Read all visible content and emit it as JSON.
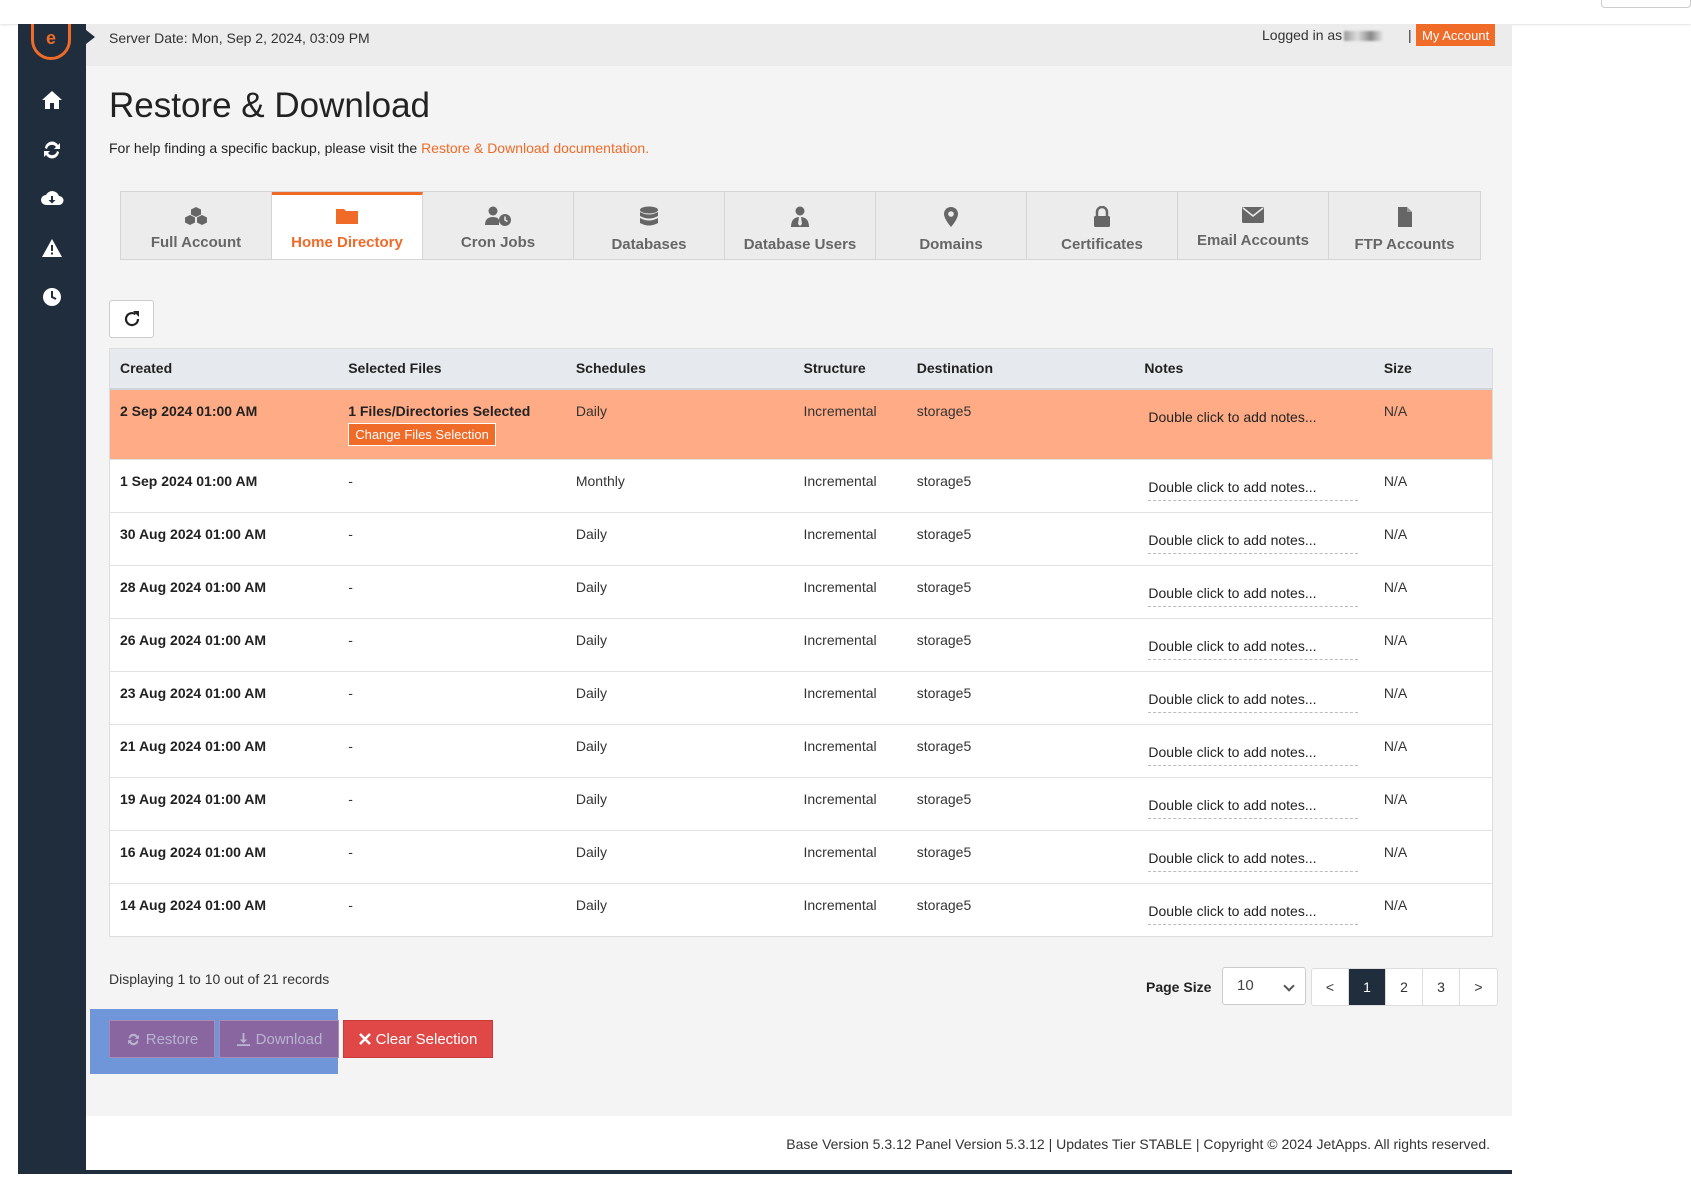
{
  "header": {
    "server_date": "Server Date: Mon, Sep 2, 2024, 03:09 PM",
    "logged_in": "Logged in as",
    "pipe": "|",
    "my_account": "My Account"
  },
  "sidebar": {
    "logo_text": "e",
    "items": [
      {
        "name": "home",
        "icon": "home-icon"
      },
      {
        "name": "sync",
        "icon": "refresh-icon"
      },
      {
        "name": "download",
        "icon": "cloud-download-icon"
      },
      {
        "name": "alerts",
        "icon": "warning-icon"
      },
      {
        "name": "history",
        "icon": "clock-icon"
      }
    ]
  },
  "page": {
    "title": "Restore & Download",
    "help_prefix": "For help finding a specific backup, please visit the ",
    "help_link": "Restore & Download documentation."
  },
  "tabs": [
    {
      "label": "Full Account",
      "icon": "cubes-icon",
      "active": false
    },
    {
      "label": "Home Directory",
      "icon": "folder-icon",
      "active": true
    },
    {
      "label": "Cron Jobs",
      "icon": "user-clock-icon",
      "active": false
    },
    {
      "label": "Databases",
      "icon": "database-icon",
      "active": false
    },
    {
      "label": "Database Users",
      "icon": "user-tie-icon",
      "active": false
    },
    {
      "label": "Domains",
      "icon": "map-marker-icon",
      "active": false
    },
    {
      "label": "Certificates",
      "icon": "lock-icon",
      "active": false
    },
    {
      "label": "Email Accounts",
      "icon": "envelope-icon",
      "active": false
    },
    {
      "label": "FTP Accounts",
      "icon": "file-icon",
      "active": false
    }
  ],
  "table": {
    "columns": [
      "Created",
      "Selected Files",
      "Schedules",
      "Structure",
      "Destination",
      "Notes",
      "Size"
    ],
    "change_files_label": "Change Files Selection",
    "rows": [
      {
        "created": "2 Sep 2024 01:00 AM",
        "files": "1 Files/Directories Selected",
        "schedule": "Daily",
        "structure": "Incremental",
        "destination": "storage5",
        "notes": "Double click to add notes...",
        "size": "N/A",
        "selected": true
      },
      {
        "created": "1 Sep 2024 01:00 AM",
        "files": "-",
        "schedule": "Monthly",
        "structure": "Incremental",
        "destination": "storage5",
        "notes": "Double click to add notes...",
        "size": "N/A",
        "selected": false
      },
      {
        "created": "30 Aug 2024 01:00 AM",
        "files": "-",
        "schedule": "Daily",
        "structure": "Incremental",
        "destination": "storage5",
        "notes": "Double click to add notes...",
        "size": "N/A",
        "selected": false
      },
      {
        "created": "28 Aug 2024 01:00 AM",
        "files": "-",
        "schedule": "Daily",
        "structure": "Incremental",
        "destination": "storage5",
        "notes": "Double click to add notes...",
        "size": "N/A",
        "selected": false
      },
      {
        "created": "26 Aug 2024 01:00 AM",
        "files": "-",
        "schedule": "Daily",
        "structure": "Incremental",
        "destination": "storage5",
        "notes": "Double click to add notes...",
        "size": "N/A",
        "selected": false
      },
      {
        "created": "23 Aug 2024 01:00 AM",
        "files": "-",
        "schedule": "Daily",
        "structure": "Incremental",
        "destination": "storage5",
        "notes": "Double click to add notes...",
        "size": "N/A",
        "selected": false
      },
      {
        "created": "21 Aug 2024 01:00 AM",
        "files": "-",
        "schedule": "Daily",
        "structure": "Incremental",
        "destination": "storage5",
        "notes": "Double click to add notes...",
        "size": "N/A",
        "selected": false
      },
      {
        "created": "19 Aug 2024 01:00 AM",
        "files": "-",
        "schedule": "Daily",
        "structure": "Incremental",
        "destination": "storage5",
        "notes": "Double click to add notes...",
        "size": "N/A",
        "selected": false
      },
      {
        "created": "16 Aug 2024 01:00 AM",
        "files": "-",
        "schedule": "Daily",
        "structure": "Incremental",
        "destination": "storage5",
        "notes": "Double click to add notes...",
        "size": "N/A",
        "selected": false
      },
      {
        "created": "14 Aug 2024 01:00 AM",
        "files": "-",
        "schedule": "Daily",
        "structure": "Incremental",
        "destination": "storage5",
        "notes": "Double click to add notes...",
        "size": "N/A",
        "selected": false
      }
    ]
  },
  "pagination": {
    "displaying": "Displaying 1 to 10 out of 21 records",
    "page_size_label": "Page Size",
    "page_size_value": "10",
    "prev": "<",
    "next": ">",
    "pages": [
      "1",
      "2",
      "3"
    ],
    "current_page": "1"
  },
  "actions": {
    "restore": "Restore",
    "download": "Download",
    "clear": "Clear Selection"
  },
  "footer": {
    "text": "Base Version 5.3.12 Panel Version 5.3.12 | Updates Tier STABLE | Copyright © 2024 JetApps. All rights reserved."
  },
  "colors": {
    "accent": "#f06a28",
    "sidebar": "#1f2d3d",
    "selected_row": "#ffab85",
    "danger": "#e04848",
    "disabled_purple": "#8a66a0",
    "highlight_box": "#6f96d8"
  }
}
